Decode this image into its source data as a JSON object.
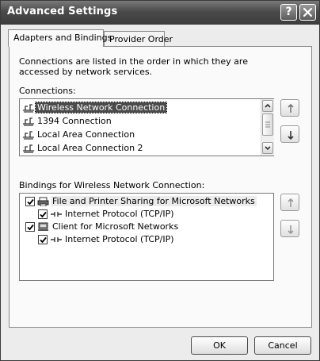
{
  "window": {
    "title": "Advanced Settings"
  },
  "titlebar": {
    "help_glyph": "?"
  },
  "tabs": [
    {
      "label": "Adapters and Bindings",
      "active": true
    },
    {
      "label": "Provider Order",
      "active": false
    }
  ],
  "description": "Connections are listed in the order in which they are accessed by network services.",
  "connections": {
    "label": "Connections:",
    "items": [
      {
        "label": "Wireless Network Connection",
        "selected": true
      },
      {
        "label": "1394 Connection",
        "selected": false
      },
      {
        "label": "Local Area Connection",
        "selected": false
      },
      {
        "label": "Local Area Connection 2",
        "selected": false
      }
    ]
  },
  "bindings": {
    "label": "Bindings for Wireless Network Connection:",
    "items": [
      {
        "label": "File and Printer Sharing for Microsoft Networks",
        "checked": true,
        "level": 0,
        "icon": "printer-share-icon"
      },
      {
        "label": "Internet Protocol (TCP/IP)",
        "checked": true,
        "level": 1,
        "icon": "protocol-icon"
      },
      {
        "label": "Client for Microsoft Networks",
        "checked": true,
        "level": 0,
        "icon": "client-computer-icon"
      },
      {
        "label": "Internet Protocol (TCP/IP)",
        "checked": true,
        "level": 1,
        "icon": "protocol-icon"
      }
    ]
  },
  "buttons": {
    "ok": "OK",
    "cancel": "Cancel"
  },
  "colors": {
    "titlebar": "#4a4a4a",
    "selection": "#4b4b4b",
    "window_bg": "#ececec"
  }
}
